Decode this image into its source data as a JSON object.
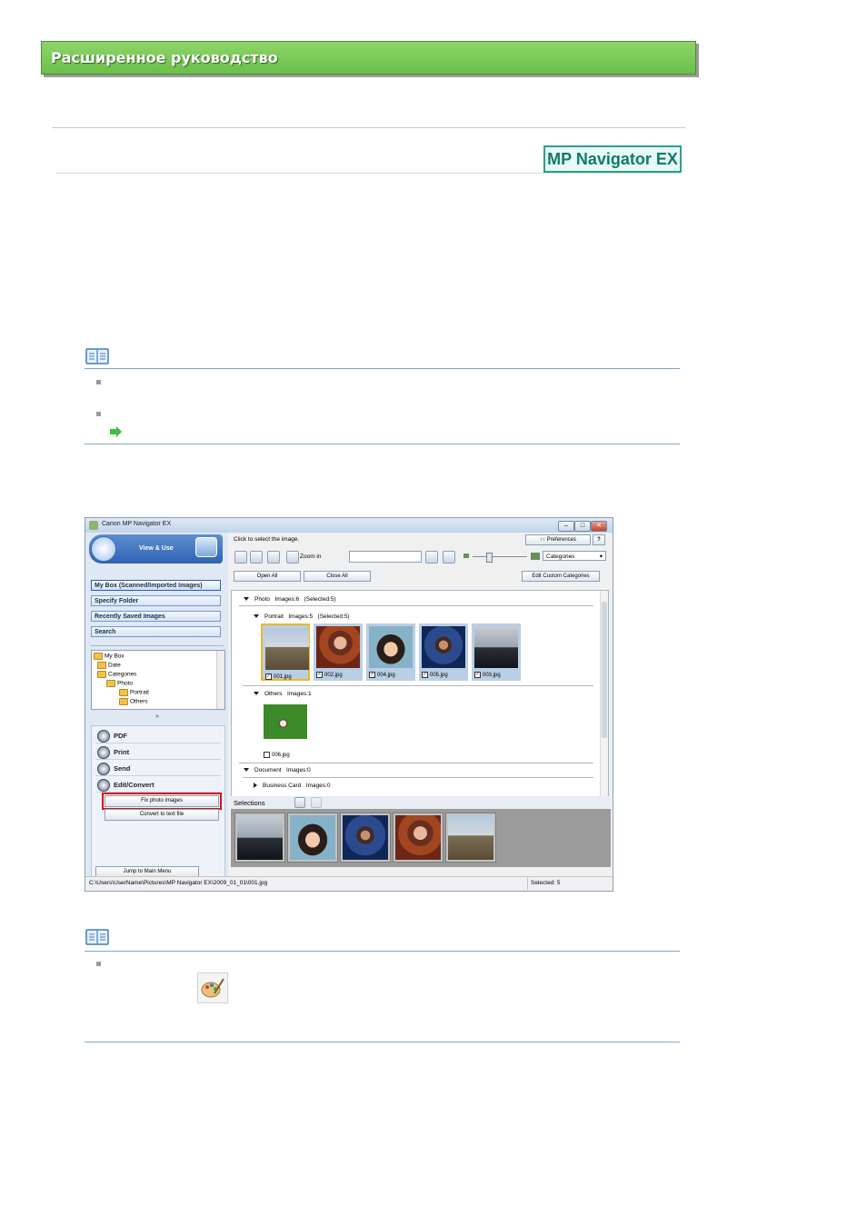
{
  "header": {
    "title": "Расширенное руководство"
  },
  "logo": {
    "text": "MP Navigator EX"
  },
  "app": {
    "window_title": "Canon MP Navigator EX",
    "mode_label": "View & Use",
    "nav": [
      {
        "label": "My Box (Scanned/Imported Images)"
      },
      {
        "label": "Specify Folder"
      },
      {
        "label": "Recently Saved Images"
      },
      {
        "label": "Search"
      }
    ],
    "tree": [
      "My Box",
      "Date",
      "Categories",
      "Photo",
      "Portrait",
      "Others"
    ],
    "actions": {
      "pdf": "PDF",
      "print": "Print",
      "send": "Send",
      "edit": "Edit/Convert",
      "fix_photo": "Fix photo images",
      "convert_text": "Convert to text file",
      "jump_main": "Jump to Main Menu"
    },
    "toolbar": {
      "instruction": "Click to select the image.",
      "preferences": "Preferences",
      "help": "?",
      "zoom_in": "Zoom in",
      "view_select": "Categories",
      "open_all": "Open All",
      "close_all": "Close All",
      "edit_categories": "Edit Custom Categories"
    },
    "groups": {
      "photo": {
        "name": "Photo",
        "count": "Images:6",
        "selected": "(Selected:5)"
      },
      "portrait": {
        "name": "Portrait",
        "count": "Images:5",
        "selected": "(Selected:5)"
      },
      "others": {
        "name": "Others",
        "count": "Images:1"
      },
      "document": {
        "name": "Document",
        "count": "Images:0"
      },
      "business": {
        "name": "Business Card",
        "count": "Images:0"
      }
    },
    "thumbs": [
      "001.jpg",
      "002.jpg",
      "004.jpg",
      "005.jpg",
      "003.jpg"
    ],
    "others_thumb": "006.jpg",
    "selections_label": "Selections",
    "status": {
      "path": "C:\\Users\\UserName\\Pictures\\MP Navigator EX\\2009_01_01\\001.jpg",
      "selected": "Selected: 5"
    }
  }
}
